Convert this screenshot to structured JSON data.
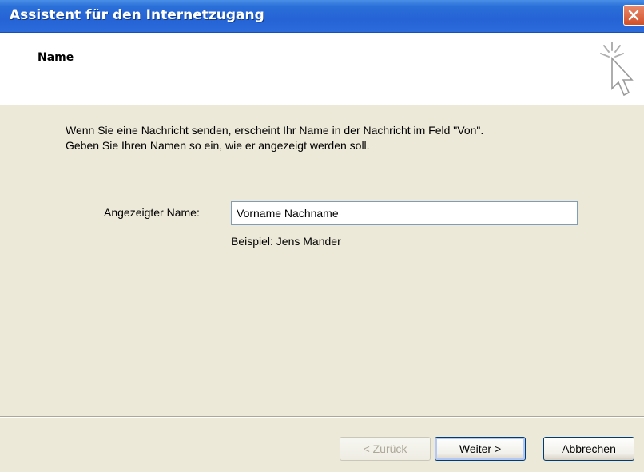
{
  "window": {
    "title": "Assistent für den Internetzugang",
    "close_icon": "close-icon"
  },
  "header": {
    "title": "Name",
    "icon": "wizard-cursor-icon"
  },
  "body": {
    "intro_line1": "Wenn Sie eine Nachricht senden, erscheint Ihr Name in der Nachricht im Feld \"Von\".",
    "intro_line2": "Geben Sie Ihren Namen so ein, wie er angezeigt werden soll.",
    "field_label": "Angezeigter Name:",
    "field_value": "Vorname Nachname",
    "example": "Beispiel: Jens Mander"
  },
  "buttons": {
    "back": "< Zurück",
    "next": "Weiter >",
    "cancel": "Abbrechen"
  },
  "colors": {
    "titlebar": "#2563d6",
    "dialog_bg": "#ece9d8",
    "header_bg": "#ffffff"
  }
}
